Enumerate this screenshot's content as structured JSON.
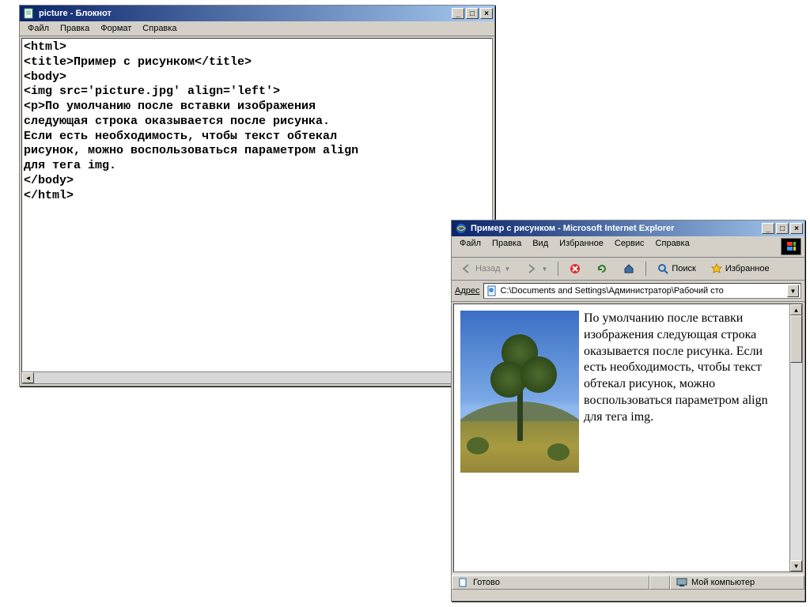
{
  "notepad": {
    "title": "picture - Блокнот",
    "menu": {
      "file": "Файл",
      "edit": "Правка",
      "format": "Формат",
      "help": "Справка"
    },
    "body": "<html>\n<title>Пример с рисунком</title>\n<body>\n<img src='picture.jpg' align='left'>\n<p>По умолчанию после вставки изображения\nследующая строка оказывается после рисунка.\nЕсли есть необходимость, чтобы текст обтекал\nрисунок, можно воспользоваться параметром align\nдля тега img.\n</body>\n</html>"
  },
  "ie": {
    "title": "Пример с рисунком - Microsoft Internet Explorer",
    "menu": {
      "file": "Файл",
      "edit": "Правка",
      "view": "Вид",
      "fav": "Избранное",
      "tools": "Сервис",
      "help": "Справка"
    },
    "toolbar": {
      "back": "Назад",
      "stop": "",
      "refresh": "",
      "home": "",
      "search": "Поиск",
      "favorites": "Избранное"
    },
    "address_label": "Адрес",
    "address_value": "C:\\Documents and Settings\\Администратор\\Рабочий сто",
    "page_text": "По умолчанию после вставки изображения следующая строка оказывается после рисунка. Если есть необходимость, чтобы текст обтекал рисунок, можно воспользоваться параметром align для тега img.",
    "status_ready": "Готово",
    "status_zone": "Мой компьютер"
  },
  "winbuttons": {
    "min": "_",
    "max": "□",
    "close": "×"
  }
}
